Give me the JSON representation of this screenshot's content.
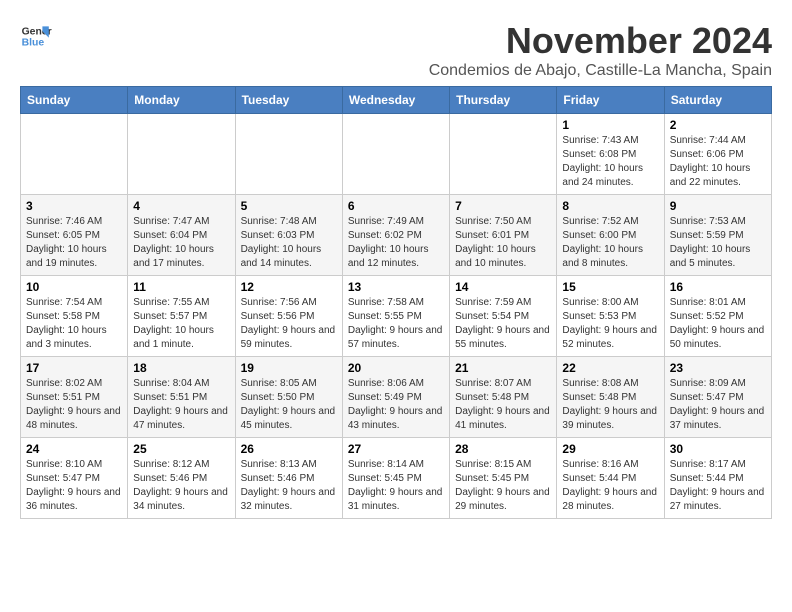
{
  "logo": {
    "line1": "General",
    "line2": "Blue"
  },
  "title": "November 2024",
  "location": "Condemios de Abajo, Castille-La Mancha, Spain",
  "weekdays": [
    "Sunday",
    "Monday",
    "Tuesday",
    "Wednesday",
    "Thursday",
    "Friday",
    "Saturday"
  ],
  "weeks": [
    [
      {
        "day": "",
        "info": ""
      },
      {
        "day": "",
        "info": ""
      },
      {
        "day": "",
        "info": ""
      },
      {
        "day": "",
        "info": ""
      },
      {
        "day": "",
        "info": ""
      },
      {
        "day": "1",
        "info": "Sunrise: 7:43 AM\nSunset: 6:08 PM\nDaylight: 10 hours and 24 minutes."
      },
      {
        "day": "2",
        "info": "Sunrise: 7:44 AM\nSunset: 6:06 PM\nDaylight: 10 hours and 22 minutes."
      }
    ],
    [
      {
        "day": "3",
        "info": "Sunrise: 7:46 AM\nSunset: 6:05 PM\nDaylight: 10 hours and 19 minutes."
      },
      {
        "day": "4",
        "info": "Sunrise: 7:47 AM\nSunset: 6:04 PM\nDaylight: 10 hours and 17 minutes."
      },
      {
        "day": "5",
        "info": "Sunrise: 7:48 AM\nSunset: 6:03 PM\nDaylight: 10 hours and 14 minutes."
      },
      {
        "day": "6",
        "info": "Sunrise: 7:49 AM\nSunset: 6:02 PM\nDaylight: 10 hours and 12 minutes."
      },
      {
        "day": "7",
        "info": "Sunrise: 7:50 AM\nSunset: 6:01 PM\nDaylight: 10 hours and 10 minutes."
      },
      {
        "day": "8",
        "info": "Sunrise: 7:52 AM\nSunset: 6:00 PM\nDaylight: 10 hours and 8 minutes."
      },
      {
        "day": "9",
        "info": "Sunrise: 7:53 AM\nSunset: 5:59 PM\nDaylight: 10 hours and 5 minutes."
      }
    ],
    [
      {
        "day": "10",
        "info": "Sunrise: 7:54 AM\nSunset: 5:58 PM\nDaylight: 10 hours and 3 minutes."
      },
      {
        "day": "11",
        "info": "Sunrise: 7:55 AM\nSunset: 5:57 PM\nDaylight: 10 hours and 1 minute."
      },
      {
        "day": "12",
        "info": "Sunrise: 7:56 AM\nSunset: 5:56 PM\nDaylight: 9 hours and 59 minutes."
      },
      {
        "day": "13",
        "info": "Sunrise: 7:58 AM\nSunset: 5:55 PM\nDaylight: 9 hours and 57 minutes."
      },
      {
        "day": "14",
        "info": "Sunrise: 7:59 AM\nSunset: 5:54 PM\nDaylight: 9 hours and 55 minutes."
      },
      {
        "day": "15",
        "info": "Sunrise: 8:00 AM\nSunset: 5:53 PM\nDaylight: 9 hours and 52 minutes."
      },
      {
        "day": "16",
        "info": "Sunrise: 8:01 AM\nSunset: 5:52 PM\nDaylight: 9 hours and 50 minutes."
      }
    ],
    [
      {
        "day": "17",
        "info": "Sunrise: 8:02 AM\nSunset: 5:51 PM\nDaylight: 9 hours and 48 minutes."
      },
      {
        "day": "18",
        "info": "Sunrise: 8:04 AM\nSunset: 5:51 PM\nDaylight: 9 hours and 47 minutes."
      },
      {
        "day": "19",
        "info": "Sunrise: 8:05 AM\nSunset: 5:50 PM\nDaylight: 9 hours and 45 minutes."
      },
      {
        "day": "20",
        "info": "Sunrise: 8:06 AM\nSunset: 5:49 PM\nDaylight: 9 hours and 43 minutes."
      },
      {
        "day": "21",
        "info": "Sunrise: 8:07 AM\nSunset: 5:48 PM\nDaylight: 9 hours and 41 minutes."
      },
      {
        "day": "22",
        "info": "Sunrise: 8:08 AM\nSunset: 5:48 PM\nDaylight: 9 hours and 39 minutes."
      },
      {
        "day": "23",
        "info": "Sunrise: 8:09 AM\nSunset: 5:47 PM\nDaylight: 9 hours and 37 minutes."
      }
    ],
    [
      {
        "day": "24",
        "info": "Sunrise: 8:10 AM\nSunset: 5:47 PM\nDaylight: 9 hours and 36 minutes."
      },
      {
        "day": "25",
        "info": "Sunrise: 8:12 AM\nSunset: 5:46 PM\nDaylight: 9 hours and 34 minutes."
      },
      {
        "day": "26",
        "info": "Sunrise: 8:13 AM\nSunset: 5:46 PM\nDaylight: 9 hours and 32 minutes."
      },
      {
        "day": "27",
        "info": "Sunrise: 8:14 AM\nSunset: 5:45 PM\nDaylight: 9 hours and 31 minutes."
      },
      {
        "day": "28",
        "info": "Sunrise: 8:15 AM\nSunset: 5:45 PM\nDaylight: 9 hours and 29 minutes."
      },
      {
        "day": "29",
        "info": "Sunrise: 8:16 AM\nSunset: 5:44 PM\nDaylight: 9 hours and 28 minutes."
      },
      {
        "day": "30",
        "info": "Sunrise: 8:17 AM\nSunset: 5:44 PM\nDaylight: 9 hours and 27 minutes."
      }
    ]
  ]
}
